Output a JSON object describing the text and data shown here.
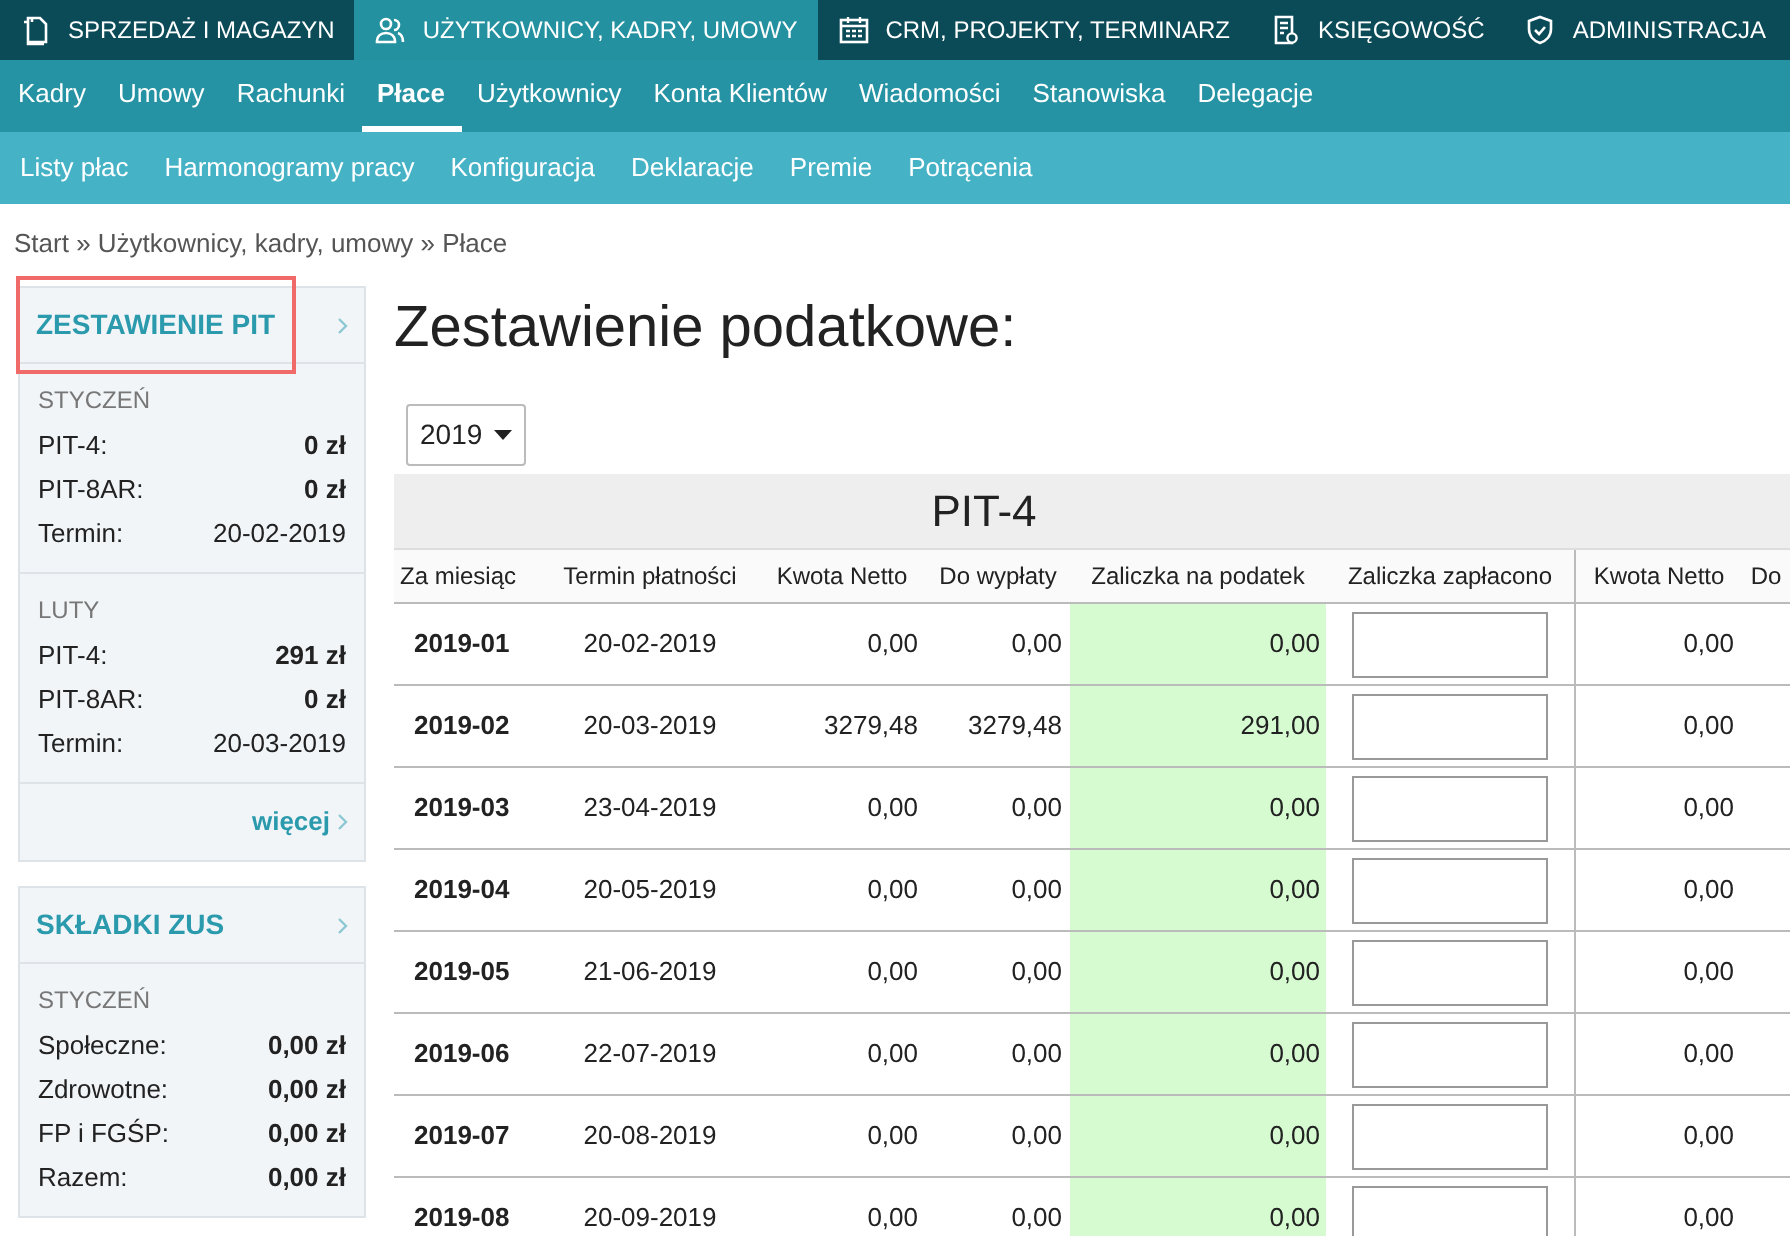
{
  "top_tabs": [
    {
      "label": "SPRZEDAŻ I MAGAZYN",
      "selected": false
    },
    {
      "label": "UŻYTKOWNICY, KADRY, UMOWY",
      "selected": true
    },
    {
      "label": "CRM, PROJEKTY, TERMINARZ",
      "selected": false
    },
    {
      "label": "KSIĘGOWOŚĆ",
      "selected": false
    },
    {
      "label": "ADMINISTRACJA",
      "selected": false
    }
  ],
  "nav": [
    {
      "label": "Kadry",
      "selected": false
    },
    {
      "label": "Umowy",
      "selected": false
    },
    {
      "label": "Rachunki",
      "selected": false
    },
    {
      "label": "Płace",
      "selected": true
    },
    {
      "label": "Użytkownicy",
      "selected": false
    },
    {
      "label": "Konta Klientów",
      "selected": false
    },
    {
      "label": "Wiadomości",
      "selected": false
    },
    {
      "label": "Stanowiska",
      "selected": false
    },
    {
      "label": "Delegacje",
      "selected": false
    }
  ],
  "subnav": [
    "Listy płac",
    "Harmonogramy pracy",
    "Konfiguracja",
    "Deklaracje",
    "Premie",
    "Potrącenia"
  ],
  "breadcrumb": "Start » Użytkownicy, kadry, umowy » Płace",
  "sidebar": [
    {
      "title": "ZESTAWIENIE PIT",
      "highlighted": true,
      "sections": [
        {
          "month": "STYCZEŃ",
          "rows": [
            {
              "label": "PIT-4:",
              "value": "0 zł",
              "kind": "amount"
            },
            {
              "label": "PIT-8AR:",
              "value": "0 zł",
              "kind": "amount"
            },
            {
              "label": "Termin:",
              "value": "20-02-2019",
              "kind": "date"
            }
          ]
        },
        {
          "month": "LUTY",
          "rows": [
            {
              "label": "PIT-4:",
              "value": "291 zł",
              "kind": "amount"
            },
            {
              "label": "PIT-8AR:",
              "value": "0 zł",
              "kind": "amount"
            },
            {
              "label": "Termin:",
              "value": "20-03-2019",
              "kind": "date"
            }
          ]
        }
      ],
      "more": "więcej"
    },
    {
      "title": "SKŁADKI ZUS",
      "highlighted": false,
      "sections": [
        {
          "month": "STYCZEŃ",
          "rows": [
            {
              "label": "Społeczne:",
              "value": "0,00 zł",
              "kind": "amount"
            },
            {
              "label": "Zdrowotne:",
              "value": "0,00 zł",
              "kind": "amount"
            },
            {
              "label": "FP i FGŚP:",
              "value": "0,00 zł",
              "kind": "amount"
            },
            {
              "label": "Razem:",
              "value": "0,00 zł",
              "kind": "amount"
            }
          ]
        }
      ]
    }
  ],
  "title": "Zestawienie podatkowe:",
  "year": "2019",
  "table": {
    "group_title": "PIT-4",
    "columns": [
      "Za miesiąc",
      "Termin płatności",
      "Kwota Netto",
      "Do wypłaty",
      "Zaliczka na podatek",
      "Zaliczka zapłacono",
      "Kwota Netto",
      "Do"
    ],
    "rows": [
      [
        "2019-01",
        "20-02-2019",
        "0,00",
        "0,00",
        "0,00",
        "",
        "0,00"
      ],
      [
        "2019-02",
        "20-03-2019",
        "3279,48",
        "3279,48",
        "291,00",
        "",
        "0,00"
      ],
      [
        "2019-03",
        "23-04-2019",
        "0,00",
        "0,00",
        "0,00",
        "",
        "0,00"
      ],
      [
        "2019-04",
        "20-05-2019",
        "0,00",
        "0,00",
        "0,00",
        "",
        "0,00"
      ],
      [
        "2019-05",
        "21-06-2019",
        "0,00",
        "0,00",
        "0,00",
        "",
        "0,00"
      ],
      [
        "2019-06",
        "22-07-2019",
        "0,00",
        "0,00",
        "0,00",
        "",
        "0,00"
      ],
      [
        "2019-07",
        "20-08-2019",
        "0,00",
        "0,00",
        "0,00",
        "",
        "0,00"
      ],
      [
        "2019-08",
        "20-09-2019",
        "0,00",
        "0,00",
        "0,00",
        "",
        "0,00"
      ]
    ]
  }
}
